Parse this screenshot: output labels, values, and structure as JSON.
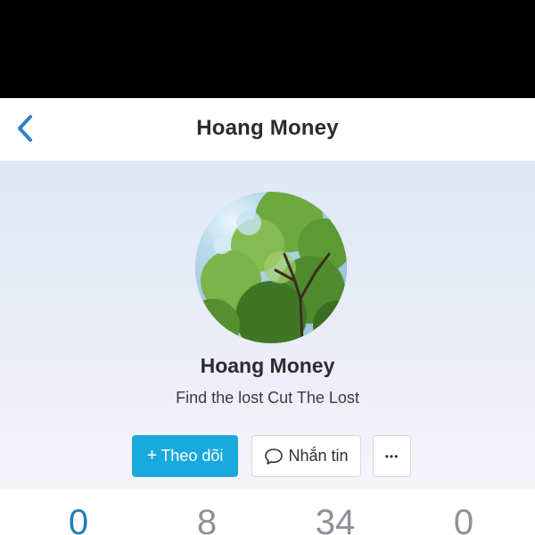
{
  "header": {
    "title": "Hoang Money"
  },
  "profile": {
    "name": "Hoang Money",
    "bio": "Find the lost Cut The Lost"
  },
  "actions": {
    "follow_label": "Theo dõi",
    "follow_plus": "+",
    "message_label": "Nhắn tin",
    "more_label": "•••"
  },
  "stats": [
    {
      "value": "0"
    },
    {
      "value": "8"
    },
    {
      "value": "34"
    },
    {
      "value": "0"
    }
  ],
  "colors": {
    "accent": "#1aa9dc",
    "active_stat": "#1f7fb9",
    "back_arrow": "#2f80c8"
  },
  "icons": {
    "back": "chevron-left-icon",
    "avatar_photo": "tree-photo",
    "message": "chat-bubble-icon",
    "more": "more-dots-icon"
  }
}
